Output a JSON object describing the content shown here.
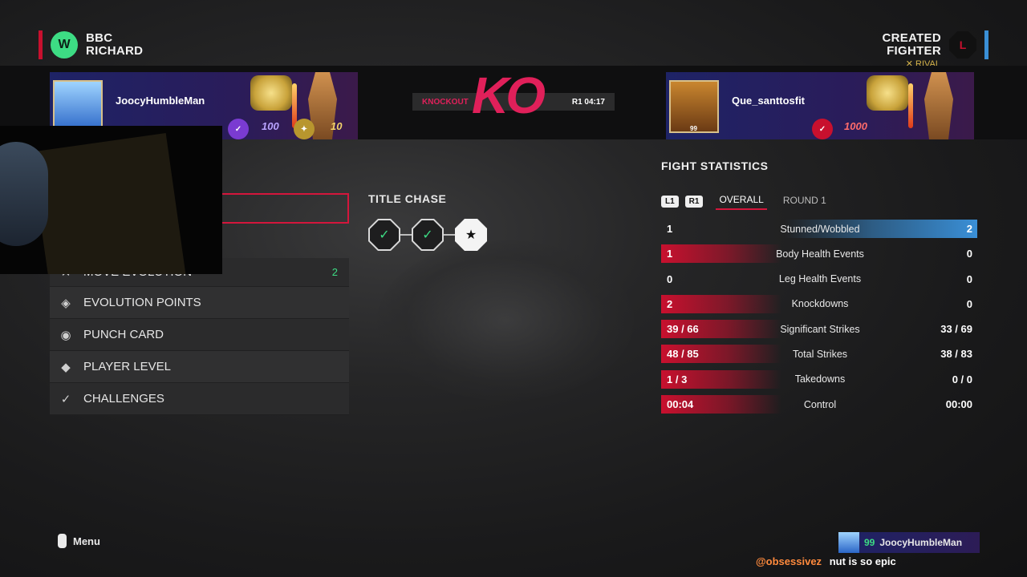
{
  "players": {
    "left": {
      "badge": "W",
      "name_line1": "BBC",
      "name_line2": "RICHARD",
      "corner_color": "#c8102e"
    },
    "right": {
      "badge": "L",
      "name_line1": "CREATED",
      "name_line2": "FIGHTER",
      "corner_color": "#3a8fd6",
      "tag": "RIVAL"
    }
  },
  "fighter_cards": {
    "left": {
      "username": "JoocyHumbleMan",
      "badge_value": "100",
      "badge_value_2": "10"
    },
    "right": {
      "username": "Que_santtosfit",
      "ovr": "99",
      "badge_value": "1000"
    }
  },
  "result": {
    "mark": "KO",
    "method": "KNOCKOUT",
    "time": "R1 04:17"
  },
  "menu": {
    "items": [
      {
        "label": "MOVE EVOLUTION",
        "count": "2",
        "icon": "move-evolution-icon"
      },
      {
        "label": "EVOLUTION POINTS",
        "icon": "evolution-points-icon"
      },
      {
        "label": "PUNCH CARD",
        "icon": "punch-card-icon"
      },
      {
        "label": "PLAYER LEVEL",
        "icon": "player-level-icon"
      },
      {
        "label": "CHALLENGES",
        "icon": "challenges-icon"
      }
    ]
  },
  "title_chase": {
    "title": "TITLE CHASE",
    "steps": [
      "check",
      "check",
      "star"
    ]
  },
  "fight_stats": {
    "title": "FIGHT STATISTICS",
    "key_left": "L1",
    "key_right": "R1",
    "tabs": [
      "OVERALL",
      "ROUND 1"
    ],
    "rows": [
      {
        "label": "Stunned/Wobbled",
        "left": "1",
        "right": "2"
      },
      {
        "label": "Body Health Events",
        "left": "1",
        "right": "0"
      },
      {
        "label": "Leg Health Events",
        "left": "0",
        "right": "0"
      },
      {
        "label": "Knockdowns",
        "left": "2",
        "right": "0"
      },
      {
        "label": "Significant Strikes",
        "left": "39 / 66",
        "right": "33 / 69"
      },
      {
        "label": "Total Strikes",
        "left": "48 / 85",
        "right": "38 / 83"
      },
      {
        "label": "Takedowns",
        "left": "1 / 3",
        "right": "0 / 0"
      },
      {
        "label": "Control",
        "left": "00:04",
        "right": "00:00"
      }
    ]
  },
  "footer": {
    "menu_label": "Menu"
  },
  "mini_card": {
    "ovr": "99",
    "username": "JoocyHumbleMan"
  },
  "chat": {
    "user": "@obsessivez",
    "message": "nut is so epic"
  },
  "colors": {
    "accent_red": "#d4163c",
    "accent_green": "#3ddc84",
    "accent_blue": "#3a8fd6"
  }
}
